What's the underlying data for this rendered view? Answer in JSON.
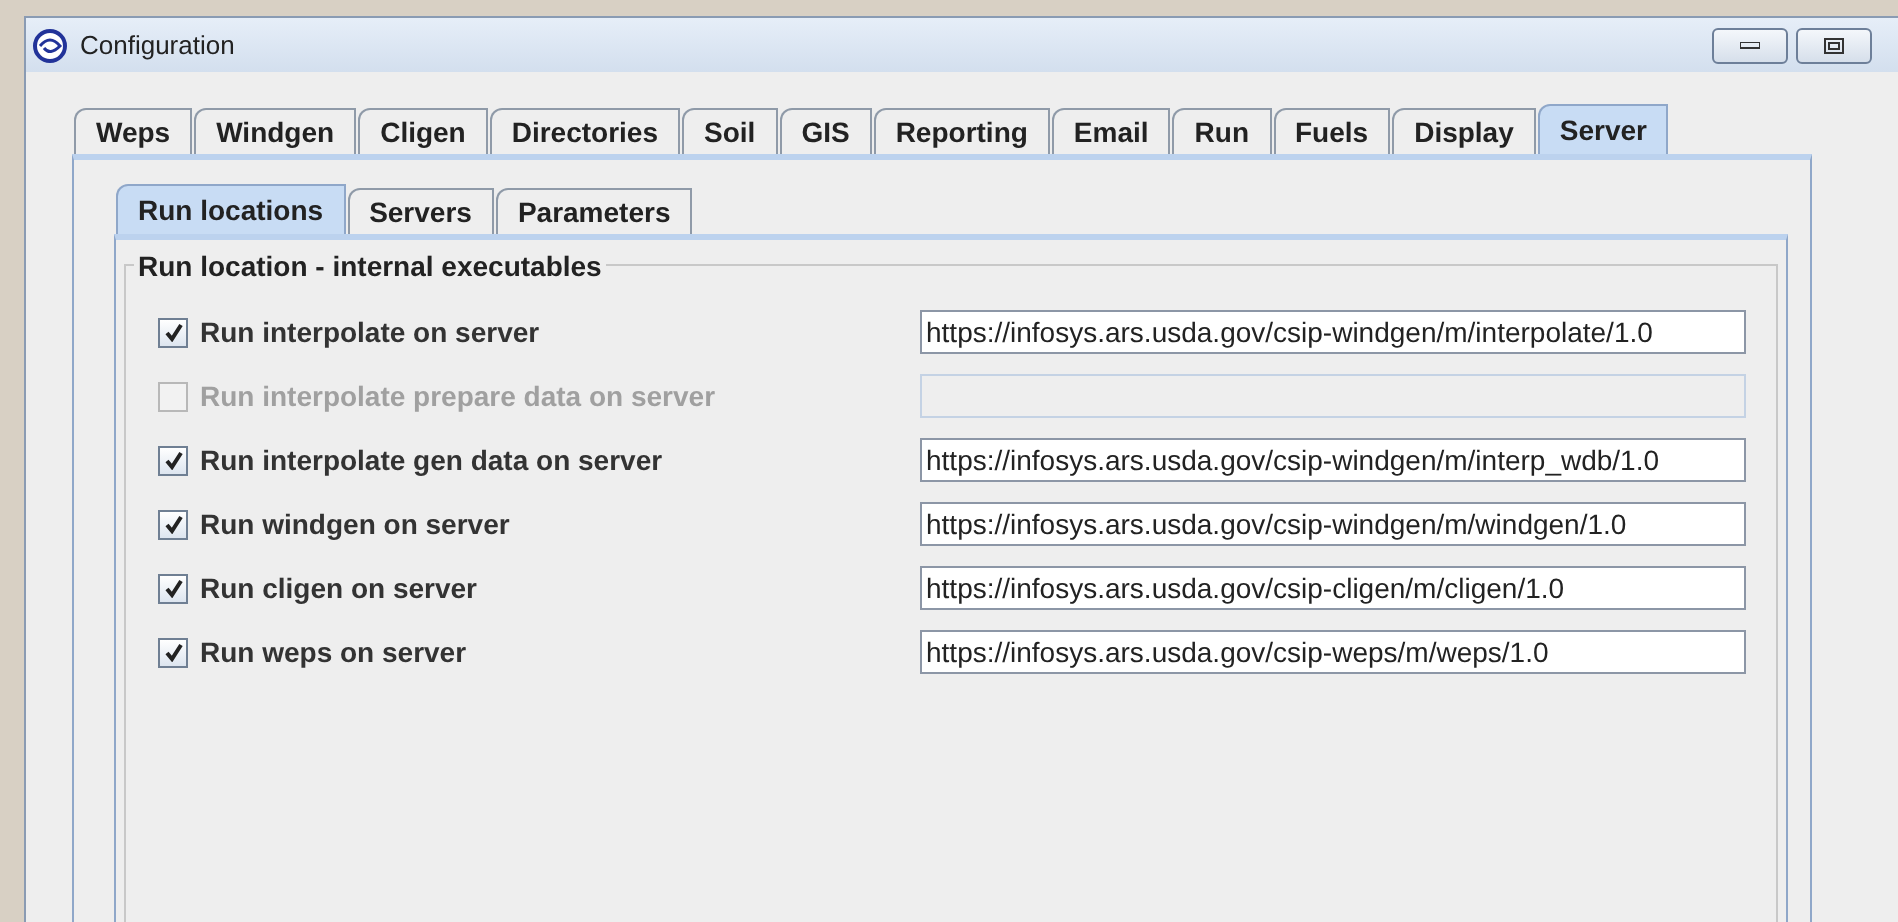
{
  "window": {
    "title": "Configuration"
  },
  "tabs": [
    {
      "label": "Weps",
      "selected": false
    },
    {
      "label": "Windgen",
      "selected": false
    },
    {
      "label": "Cligen",
      "selected": false
    },
    {
      "label": "Directories",
      "selected": false
    },
    {
      "label": "Soil",
      "selected": false
    },
    {
      "label": "GIS",
      "selected": false
    },
    {
      "label": "Reporting",
      "selected": false
    },
    {
      "label": "Email",
      "selected": false
    },
    {
      "label": "Run",
      "selected": false
    },
    {
      "label": "Fuels",
      "selected": false
    },
    {
      "label": "Display",
      "selected": false
    },
    {
      "label": "Server",
      "selected": true
    }
  ],
  "subtabs": [
    {
      "label": "Run locations",
      "selected": true
    },
    {
      "label": "Servers",
      "selected": false
    },
    {
      "label": "Parameters",
      "selected": false
    }
  ],
  "group": {
    "title": "Run location - internal executables",
    "rows": [
      {
        "label": "Run interpolate on server",
        "checked": true,
        "disabled": false,
        "value": "https://infosys.ars.usda.gov/csip-windgen/m/interpolate/1.0"
      },
      {
        "label": "Run interpolate prepare data on server",
        "checked": false,
        "disabled": true
      },
      {
        "label": "Run interpolate gen data on server",
        "checked": true,
        "disabled": false,
        "value": "https://infosys.ars.usda.gov/csip-windgen/m/interp_wdb/1.0"
      },
      {
        "label": "Run windgen on server",
        "checked": true,
        "disabled": false,
        "value": "https://infosys.ars.usda.gov/csip-windgen/m/windgen/1.0"
      },
      {
        "label": "Run cligen on server",
        "checked": true,
        "disabled": false,
        "value": "https://infosys.ars.usda.gov/csip-cligen/m/cligen/1.0"
      },
      {
        "label": "Run weps on server",
        "checked": true,
        "disabled": false,
        "value": "https://infosys.ars.usda.gov/csip-weps/m/weps/1.0"
      }
    ]
  }
}
